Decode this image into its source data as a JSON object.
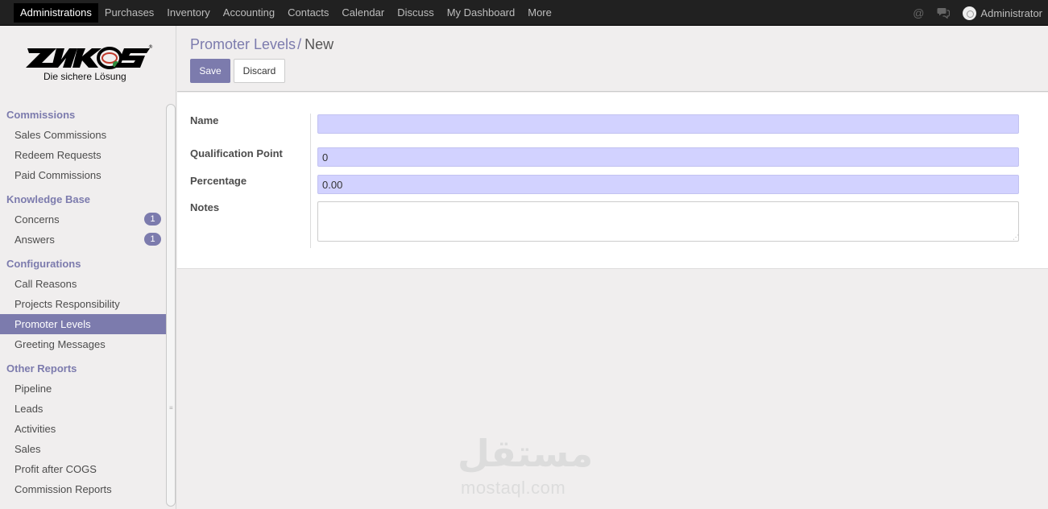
{
  "topbar": {
    "menu": [
      "Administrations",
      "Purchases",
      "Inventory",
      "Accounting",
      "Contacts",
      "Calendar",
      "Discuss",
      "My Dashboard",
      "More"
    ],
    "active_index": 0,
    "icons": [
      "at-icon",
      "chat-icon"
    ],
    "user": "Administrator"
  },
  "logo": {
    "tagline": "Die sichere Lösung"
  },
  "sidebar": {
    "sections": [
      {
        "title": "Commissions",
        "items": [
          {
            "label": "Sales Commissions"
          },
          {
            "label": "Redeem Requests"
          },
          {
            "label": "Paid Commissions"
          }
        ]
      },
      {
        "title": "Knowledge Base",
        "items": [
          {
            "label": "Concerns",
            "badge": "1"
          },
          {
            "label": "Answers",
            "badge": "1"
          }
        ]
      },
      {
        "title": "Configurations",
        "items": [
          {
            "label": "Call Reasons"
          },
          {
            "label": "Projects Responsibility"
          },
          {
            "label": "Promoter Levels",
            "active": true
          },
          {
            "label": "Greeting Messages"
          }
        ]
      },
      {
        "title": "Other Reports",
        "items": [
          {
            "label": "Pipeline"
          },
          {
            "label": "Leads"
          },
          {
            "label": "Activities"
          },
          {
            "label": "Sales"
          },
          {
            "label": "Profit after COGS"
          },
          {
            "label": "Commission Reports"
          }
        ]
      }
    ]
  },
  "breadcrumb": {
    "parent": "Promoter Levels",
    "separator": "/",
    "current": "New"
  },
  "buttons": {
    "save": "Save",
    "discard": "Discard"
  },
  "form": {
    "name_label": "Name",
    "name_value": "",
    "qualification_label": "Qualification Point",
    "qualification_value": "0",
    "percentage_label": "Percentage",
    "percentage_value": "0.00",
    "notes_label": "Notes",
    "notes_value": ""
  },
  "watermark": {
    "arabic": "مستقل",
    "latin": "mostaql.com"
  },
  "colors": {
    "accent": "#7c7bad",
    "topbar": "#212121",
    "required_field": "#d2d2ff"
  }
}
